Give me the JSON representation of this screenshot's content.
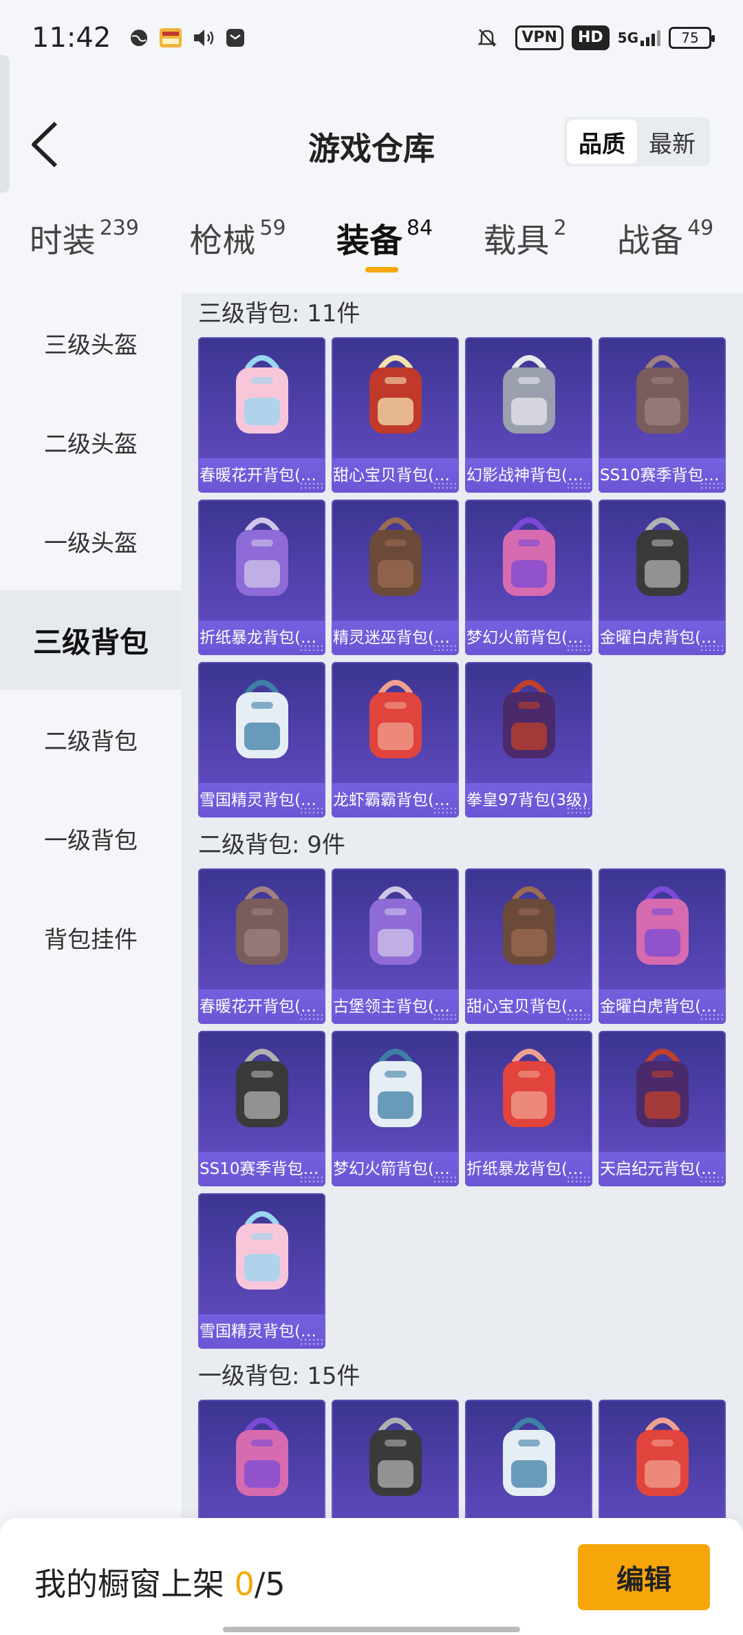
{
  "status_bar": {
    "time": "11:42",
    "left_icons": [
      "globe-icon",
      "app-thumbnail-icon",
      "volume-icon",
      "message-icon"
    ],
    "vpn": "VPN",
    "hd": "HD",
    "network": "5G",
    "battery": "75"
  },
  "header": {
    "title": "游戏仓库",
    "sort_options": [
      "品质",
      "最新"
    ],
    "active_sort": "品质"
  },
  "category_tabs": [
    {
      "label": "时装",
      "count": "239"
    },
    {
      "label": "枪械",
      "count": "59"
    },
    {
      "label": "装备",
      "count": "84",
      "active": true
    },
    {
      "label": "载具",
      "count": "2"
    },
    {
      "label": "战备",
      "count": "49"
    }
  ],
  "sidebar": {
    "items": [
      "三级头盔",
      "二级头盔",
      "一级头盔",
      "三级背包",
      "二级背包",
      "一级背包",
      "背包挂件"
    ],
    "active": "三级背包"
  },
  "sections": [
    {
      "title": "三级背包: 11件",
      "items": [
        "春暖花开背包(…",
        "甜心宝贝背包(…",
        "幻影战神背包(…",
        "SS10赛季背包…",
        "折纸暴龙背包(…",
        "精灵迷巫背包(…",
        "梦幻火箭背包(…",
        "金曜白虎背包(…",
        "雪国精灵背包(…",
        "龙虾霸霸背包(…",
        "拳皇97背包(3级)"
      ]
    },
    {
      "title": "二级背包: 9件",
      "items": [
        "春暖花开背包(…",
        "古堡领主背包(…",
        "甜心宝贝背包(…",
        "金曜白虎背包(…",
        "SS10赛季背包…",
        "梦幻火箭背包(…",
        "折纸暴龙背包(…",
        "天启纪元背包(…",
        "雪国精灵背包(…"
      ]
    },
    {
      "title": "一级背包: 15件",
      "items": [
        "",
        "",
        "",
        ""
      ]
    }
  ],
  "bottom_bar": {
    "label": "我的橱窗上架 ",
    "current": "0",
    "total": "/5",
    "edit_label": "编辑"
  },
  "colors": {
    "accent": "#f5a700",
    "card_bg": "#4b3fa6",
    "card_caption": "#6c55d4"
  }
}
